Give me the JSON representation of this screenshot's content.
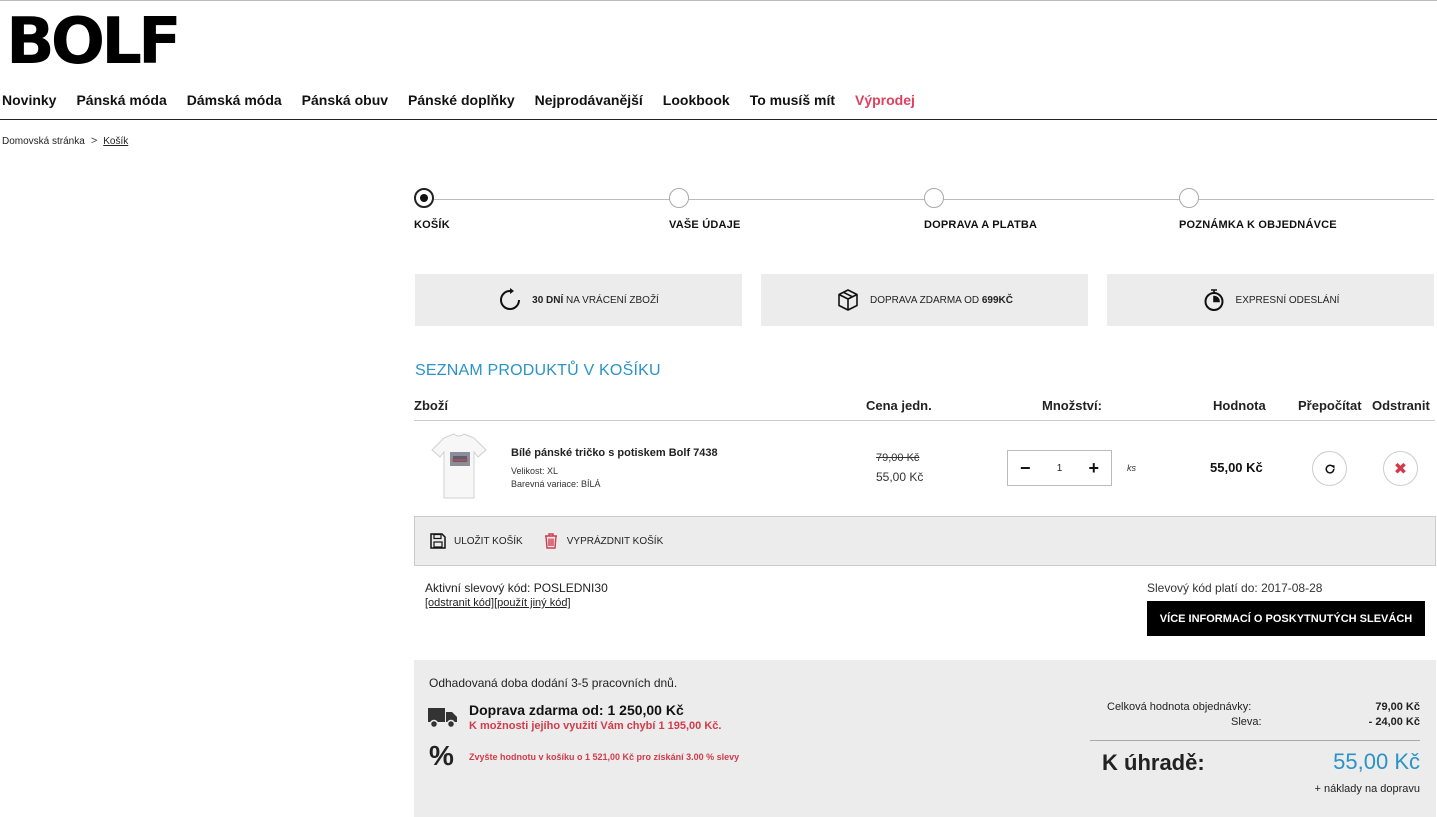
{
  "brand": {
    "logo": "BOLF"
  },
  "nav": [
    "Novinky",
    "Pánská móda",
    "Dámská móda",
    "Pánská obuv",
    "Pánské doplňky",
    "Nejprodávanější",
    "Lookbook",
    "To musíš mít",
    "Výprodej"
  ],
  "breadcrumb": {
    "home": "Domovská stránka",
    "current": "Košík",
    "separator": ">"
  },
  "steps": [
    "KOŠÍK",
    "VAŠE ÚDAJE",
    "DOPRAVA A PLATBA",
    "POZNÁMKA K OBJEDNÁVCE"
  ],
  "benefits": {
    "returns_bold": "30 DNÍ",
    "returns_rest": " NA VRÁCENÍ ZBOŽÍ",
    "shipping_rest": "DOPRAVA ZDARMA OD ",
    "shipping_bold": "699KČ",
    "express": "EXPRESNÍ ODESLÁNÍ"
  },
  "cart": {
    "title": "SEZNAM PRODUKTŮ V KOŠÍKU",
    "headers": {
      "product": "Zboží",
      "unit_price": "Cena jedn.",
      "quantity": "Množství:",
      "value": "Hodnota",
      "recalc": "Přepočítat",
      "remove": "Odstranit"
    },
    "item": {
      "name": "Bílé pánské tričko s potiskem Bolf 7438",
      "size": "Velikost: XL",
      "color": "Barevná variace: BÍLÁ",
      "price_old": "79,00 Kč",
      "price_new": "55,00 Kč",
      "qty": "1",
      "unit": "ks",
      "total": "55,00 Kč"
    },
    "actions": {
      "save": "ULOŽIT KOŠÍK",
      "empty": "VYPRÁZDNIT KOŠÍK"
    }
  },
  "discount": {
    "active": "Aktivní slevový kód: POSLEDNI30",
    "links": "[odstranit kód][použít jiný kód]",
    "valid": "Slevový kód platí do: 2017-08-28",
    "more_button": "VÍCE INFORMACÍ O POSKYTNUTÝCH SLEVÁCH"
  },
  "summary": {
    "delivery_estimate": "Odhadovaná doba dodání 3-5 pracovních dnů.",
    "free_shipping": "Doprava zdarma od: 1 250,00 Kč",
    "free_shipping_missing": "K možnosti jejího využití Vám chybí 1 195,00 Kč.",
    "percent_symbol": "%",
    "discount_hint": "Zvyšte hodnotu v košíku o 1 521,00 Kč pro získání 3.00 % slevy",
    "order_total_label": "Celková hodnota objednávky:",
    "order_total_value": "79,00 Kč",
    "discount_label": "Sleva:",
    "discount_value": "- 24,00 Kč",
    "pay_label": "K úhradě:",
    "pay_value": "55,00 Kč",
    "pay_note": "+ náklady na dopravu"
  },
  "colors": {
    "accent_blue": "#2a93c7",
    "sale_red": "#e0405f",
    "warning_red": "#d23b4b"
  }
}
